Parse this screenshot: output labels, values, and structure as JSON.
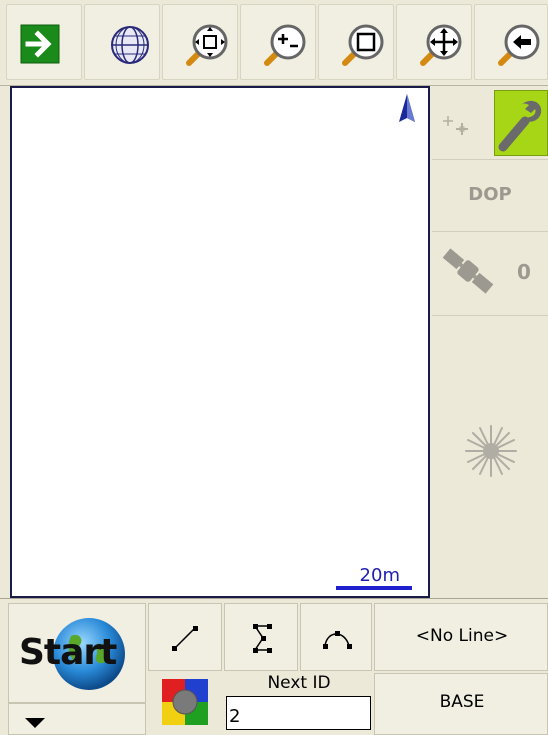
{
  "toolbar": {
    "buttons": [
      {
        "name": "exit-arrow-icon"
      },
      {
        "name": "globe-icon"
      },
      {
        "name": "zoom-extent-icon"
      },
      {
        "name": "zoom-in-out-icon"
      },
      {
        "name": "zoom-window-icon"
      },
      {
        "name": "pan-icon"
      },
      {
        "name": "zoom-previous-icon"
      }
    ]
  },
  "map": {
    "scale_label": "20m",
    "north_arrow": "north-arrow-icon"
  },
  "right_panel": {
    "dop_label": "DOP",
    "satellite_count": "0",
    "colors": {
      "active_tool": "#a6d616"
    }
  },
  "bottom": {
    "start_label": "Start",
    "line_selector": "<No Line>",
    "next_id_label": "Next ID",
    "next_id_value": "2",
    "base_label": "BASE"
  }
}
